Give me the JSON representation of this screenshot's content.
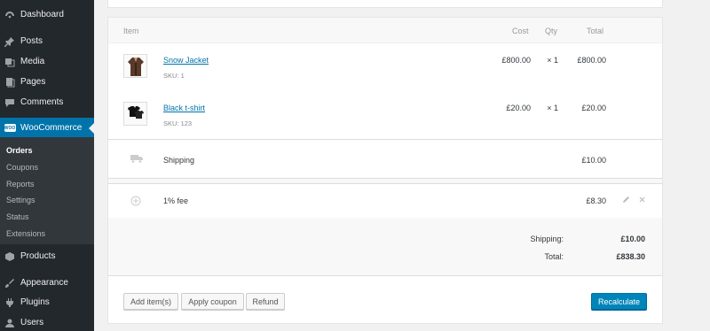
{
  "sidebar": {
    "items": [
      {
        "label": "Dashboard",
        "icon": "dashboard-icon"
      },
      {
        "label": "Posts",
        "icon": "pin-icon"
      },
      {
        "label": "Media",
        "icon": "media-icon"
      },
      {
        "label": "Pages",
        "icon": "pages-icon"
      },
      {
        "label": "Comments",
        "icon": "comment-icon"
      },
      {
        "label": "WooCommerce",
        "icon": "woo-icon"
      },
      {
        "label": "Products",
        "icon": "products-icon"
      },
      {
        "label": "Appearance",
        "icon": "appearance-icon"
      },
      {
        "label": "Plugins",
        "icon": "plugin-icon"
      },
      {
        "label": "Users",
        "icon": "users-icon"
      }
    ],
    "woo_badge": "WOO",
    "submenu": [
      "Orders",
      "Coupons",
      "Reports",
      "Settings",
      "Status",
      "Extensions"
    ]
  },
  "table": {
    "headers": {
      "item": "Item",
      "cost": "Cost",
      "qty": "Qty",
      "total": "Total"
    },
    "items": [
      {
        "name": "Snow Jacket",
        "sku": "SKU: 1",
        "cost": "£800.00",
        "qty": "× 1",
        "total": "£800.00"
      },
      {
        "name": "Black t-shirt",
        "sku": "SKU: 123",
        "cost": "£20.00",
        "qty": "× 1",
        "total": "£20.00"
      }
    ],
    "shipping": {
      "label": "Shipping",
      "total": "£10.00"
    },
    "fee": {
      "label": "1% fee",
      "total": "£8.30"
    }
  },
  "totals": {
    "shipping_label": "Shipping:",
    "shipping_value": "£10.00",
    "total_label": "Total:",
    "total_value": "£838.30"
  },
  "actions": {
    "add_items": "Add item(s)",
    "apply_coupon": "Apply coupon",
    "refund": "Refund",
    "recalculate": "Recalculate"
  },
  "colors": {
    "sidebar": "#23282d",
    "accent": "#0073aa",
    "button_primary": "#0085ba"
  }
}
